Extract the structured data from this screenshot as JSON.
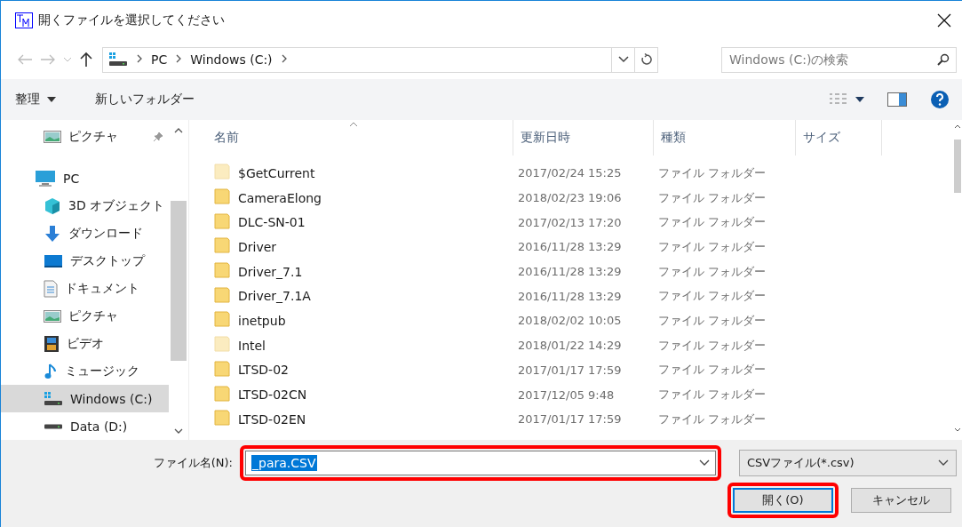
{
  "window": {
    "title": "開くファイルを選択してください"
  },
  "address_bar": {
    "path": [
      "PC",
      "Windows (C:)"
    ]
  },
  "search": {
    "placeholder": "Windows (C:)の検索"
  },
  "toolbar": {
    "organize": "整理",
    "new_folder": "新しいフォルダー"
  },
  "sidebar": {
    "items": [
      {
        "label": "ピクチャ",
        "kind": "pictures",
        "pinned": true,
        "selected": false
      },
      {
        "label": "PC",
        "kind": "pc",
        "selected": false,
        "children": [
          {
            "label": "3D オブジェクト",
            "kind": "objects3d",
            "selected": false
          },
          {
            "label": "ダウンロード",
            "kind": "download",
            "selected": false
          },
          {
            "label": "デスクトップ",
            "kind": "desktop",
            "selected": false
          },
          {
            "label": "ドキュメント",
            "kind": "documents",
            "selected": false
          },
          {
            "label": "ピクチャ",
            "kind": "pictures",
            "selected": false
          },
          {
            "label": "ビデオ",
            "kind": "video",
            "selected": false
          },
          {
            "label": "ミュージック",
            "kind": "music",
            "selected": false
          },
          {
            "label": "Windows (C:)",
            "kind": "windrive",
            "selected": true
          },
          {
            "label": "Data (D:)",
            "kind": "drive",
            "selected": false
          }
        ]
      }
    ]
  },
  "table": {
    "columns": [
      "名前",
      "更新日時",
      "種類",
      "サイズ"
    ],
    "rows": [
      {
        "name": "$GetCurrent",
        "modified": "2017/02/24 15:25",
        "type": "ファイル フォルダー",
        "hidden": true
      },
      {
        "name": "CameraElong",
        "modified": "2018/02/23 19:06",
        "type": "ファイル フォルダー",
        "hidden": false
      },
      {
        "name": "DLC-SN-01",
        "modified": "2017/02/13 17:20",
        "type": "ファイル フォルダー",
        "hidden": false
      },
      {
        "name": "Driver",
        "modified": "2016/11/28 13:29",
        "type": "ファイル フォルダー",
        "hidden": false
      },
      {
        "name": "Driver_7.1",
        "modified": "2016/11/28 13:29",
        "type": "ファイル フォルダー",
        "hidden": false
      },
      {
        "name": "Driver_7.1A",
        "modified": "2016/11/28 13:29",
        "type": "ファイル フォルダー",
        "hidden": false
      },
      {
        "name": "inetpub",
        "modified": "2018/02/02 10:05",
        "type": "ファイル フォルダー",
        "hidden": false
      },
      {
        "name": "Intel",
        "modified": "2018/01/22 14:29",
        "type": "ファイル フォルダー",
        "hidden": true
      },
      {
        "name": "LTSD-02",
        "modified": "2017/01/17 17:59",
        "type": "ファイル フォルダー",
        "hidden": false
      },
      {
        "name": "LTSD-02CN",
        "modified": "2017/12/05 9:48",
        "type": "ファイル フォルダー",
        "hidden": false
      },
      {
        "name": "LTSD-02EN",
        "modified": "2017/01/17 17:59",
        "type": "ファイル フォルダー",
        "hidden": false
      }
    ]
  },
  "file_name": {
    "label": "ファイル名(N):",
    "value": "_para.CSV",
    "highlighted": true
  },
  "file_type": {
    "value": "CSVファイル(*.csv)"
  },
  "buttons": [
    {
      "label": "開く(O)",
      "kind": "primary",
      "highlighted": true
    },
    {
      "label": "キャンセル",
      "kind": "normal",
      "highlighted": false
    }
  ]
}
